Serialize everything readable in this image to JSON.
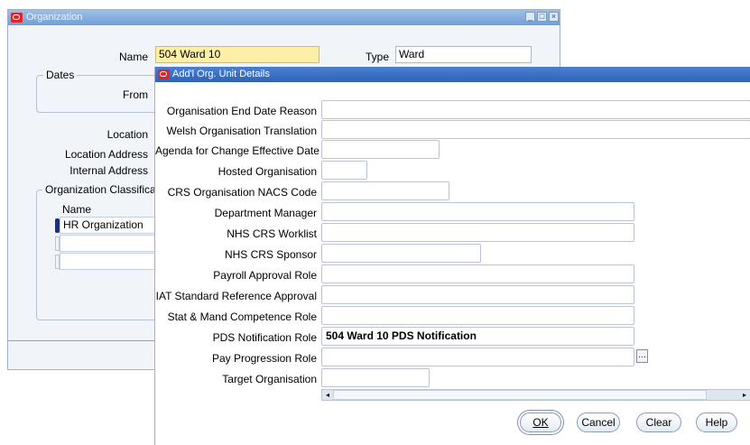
{
  "org_window": {
    "title": "Organization",
    "name_label": "Name",
    "name_value": "504 Ward 10",
    "type_label": "Type",
    "type_value": "Ward",
    "dates_group": "Dates",
    "from_label": "From",
    "location_label": "Location",
    "location_address_label": "Location Address",
    "internal_address_label": "Internal Address",
    "classification_group": "Organization Classificat",
    "col_name": "Name",
    "rows": [
      "HR Organization",
      "",
      ""
    ]
  },
  "dialog": {
    "title": "Add'l Org. Unit Details",
    "fields": [
      {
        "label": "Organisation End Date Reason",
        "value": ""
      },
      {
        "label": "Welsh Organisation Translation",
        "value": ""
      },
      {
        "label": "Agenda for Change Effective Date",
        "value": ""
      },
      {
        "label": "Hosted Organisation",
        "value": ""
      },
      {
        "label": "CRS Organisation NACS Code",
        "value": ""
      },
      {
        "label": "Department Manager",
        "value": ""
      },
      {
        "label": "NHS CRS Worklist",
        "value": ""
      },
      {
        "label": "NHS CRS Sponsor",
        "value": ""
      },
      {
        "label": "Payroll Approval Role",
        "value": ""
      },
      {
        "label": "IAT Standard Reference Approval",
        "value": ""
      },
      {
        "label": "Stat & Mand Competence Role",
        "value": ""
      },
      {
        "label": "PDS Notification Role",
        "value": "504 Ward 10 PDS Notification"
      },
      {
        "label": "Pay Progression Role",
        "value": ""
      },
      {
        "label": "Target Organisation",
        "value": ""
      }
    ],
    "buttons": {
      "ok": "OK",
      "cancel": "Cancel",
      "clear": "Clear",
      "help": "Help"
    }
  }
}
